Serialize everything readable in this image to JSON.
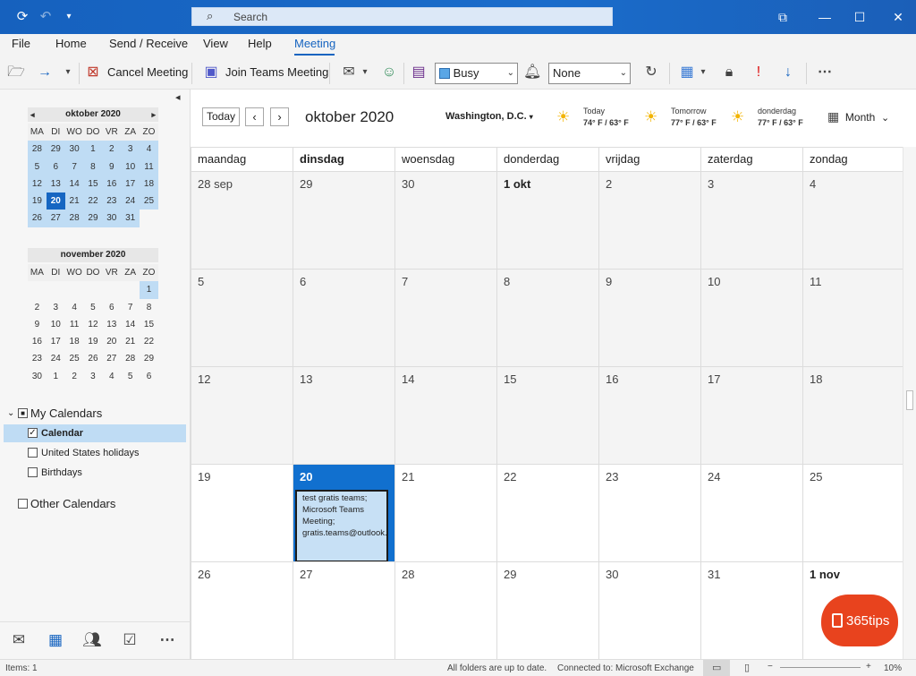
{
  "titlebar": {
    "search_placeholder": "Search",
    "icons": [
      "sync-icon",
      "undo-icon",
      "customize-icon",
      "restore-icon",
      "minimize-icon",
      "maximize-icon",
      "close-icon"
    ]
  },
  "menu": {
    "items": [
      "File",
      "Home",
      "Send / Receive",
      "View",
      "Help",
      "Meeting"
    ],
    "active": "Meeting"
  },
  "ribbon": {
    "cancel_meeting": "Cancel Meeting",
    "join_teams": "Join Teams Meeting",
    "show_as": "Busy",
    "reminder": "None"
  },
  "sidebar": {
    "october": {
      "title": "oktober 2020",
      "weekdays": [
        "MA",
        "DI",
        "WO",
        "DO",
        "VR",
        "ZA",
        "ZO"
      ],
      "rows": [
        [
          "28",
          "29",
          "30",
          "1",
          "2",
          "3",
          "4"
        ],
        [
          "5",
          "6",
          "7",
          "8",
          "9",
          "10",
          "11"
        ],
        [
          "12",
          "13",
          "14",
          "15",
          "16",
          "17",
          "18"
        ],
        [
          "19",
          "20",
          "21",
          "22",
          "23",
          "24",
          "25"
        ],
        [
          "26",
          "27",
          "28",
          "29",
          "30",
          "31",
          ""
        ]
      ],
      "today": "20"
    },
    "november": {
      "title": "november 2020",
      "weekdays": [
        "MA",
        "DI",
        "WO",
        "DO",
        "VR",
        "ZA",
        "ZO"
      ],
      "rows": [
        [
          "",
          "",
          "",
          "",
          "",
          "",
          "1"
        ],
        [
          "2",
          "3",
          "4",
          "5",
          "6",
          "7",
          "8"
        ],
        [
          "9",
          "10",
          "11",
          "12",
          "13",
          "14",
          "15"
        ],
        [
          "16",
          "17",
          "18",
          "19",
          "20",
          "21",
          "22"
        ],
        [
          "23",
          "24",
          "25",
          "26",
          "27",
          "28",
          "29"
        ],
        [
          "30",
          "1",
          "2",
          "3",
          "4",
          "5",
          "6"
        ]
      ]
    },
    "my_calendars": "My Calendars",
    "calendar": "Calendar",
    "us_holidays": "United States holidays",
    "birthdays": "Birthdays",
    "other_calendars": "Other Calendars"
  },
  "toolbar": {
    "today": "Today",
    "month_title": "oktober 2020",
    "location": "Washington,  D.C.",
    "weather": [
      {
        "label": "Today",
        "temp": "74° F / 63° F"
      },
      {
        "label": "Tomorrow",
        "temp": "77° F / 63° F"
      },
      {
        "label": "donderdag",
        "temp": "77° F / 63° F"
      }
    ],
    "view": "Month"
  },
  "grid": {
    "weekdays": [
      "maandag",
      "dinsdag",
      "woensdag",
      "donderdag",
      "vrijdag",
      "zaterdag",
      "zondag"
    ],
    "weeks": [
      [
        "28 sep",
        "29",
        "30",
        "1 okt",
        "2",
        "3",
        "4"
      ],
      [
        "5",
        "6",
        "7",
        "8",
        "9",
        "10",
        "11"
      ],
      [
        "12",
        "13",
        "14",
        "15",
        "16",
        "17",
        "18"
      ],
      [
        "19",
        "20",
        "21",
        "22",
        "23",
        "24",
        "25"
      ],
      [
        "26",
        "27",
        "28",
        "29",
        "30",
        "31",
        "1 nov"
      ]
    ],
    "event": "test gratis teams; Microsoft Teams Meeting; gratis.teams@outlook.com"
  },
  "status": {
    "items": "Items: 1",
    "sync": "All folders are up to date.",
    "connected": "Connected to: Microsoft Exchange",
    "zoom": "10%"
  },
  "logo": {
    "text": "365tips"
  },
  "colors": {
    "accent": "#1664c0",
    "today": "#1170cf",
    "selected": "#bfdcf4",
    "logo": "#e8431e"
  }
}
